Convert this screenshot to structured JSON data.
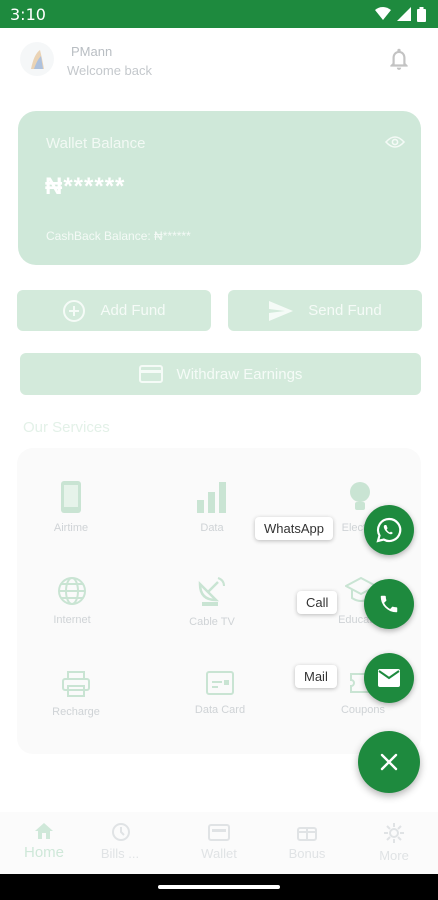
{
  "status_bar": {
    "time": "3:10"
  },
  "header": {
    "user_name": "PMann",
    "welcome": "Welcome back"
  },
  "wallet": {
    "title": "Wallet Balance",
    "amount": "₦******",
    "cashback": "CashBack Balance:  ₦******"
  },
  "actions": {
    "add_fund": "Add Fund",
    "send_fund": "Send Fund",
    "withdraw": "Withdraw Earnings"
  },
  "services": {
    "heading": "Our Services",
    "items": [
      {
        "label": "Airtime",
        "icon": "phone-icon"
      },
      {
        "label": "Data",
        "icon": "signal-bars-icon"
      },
      {
        "label": "Electr...",
        "icon": "lightbulb-icon"
      },
      {
        "label": "Internet",
        "icon": "globe-icon"
      },
      {
        "label": "Cable TV",
        "icon": "satellite-dish-icon"
      },
      {
        "label": "Educati...",
        "icon": "graduation-cap-icon"
      },
      {
        "label": "Recharge",
        "icon": "printer-icon"
      },
      {
        "label": "Data Card",
        "icon": "card-icon"
      },
      {
        "label": "Coupons",
        "icon": "ticket-icon"
      }
    ]
  },
  "fab_menu": {
    "whatsapp": "WhatsApp",
    "call": "Call",
    "mail": "Mail"
  },
  "bottom_nav": {
    "items": [
      {
        "label": "Home",
        "icon": "home-icon",
        "active": true
      },
      {
        "label": "Bills ...",
        "icon": "history-icon",
        "active": false
      },
      {
        "label": "Wallet",
        "icon": "wallet-icon",
        "active": false
      },
      {
        "label": "Bonus",
        "icon": "bonus-icon",
        "active": false
      },
      {
        "label": "More",
        "icon": "gear-icon",
        "active": false
      }
    ]
  },
  "colors": {
    "primary": "#1e8a3e",
    "card_tint": "#cfe8d9"
  }
}
